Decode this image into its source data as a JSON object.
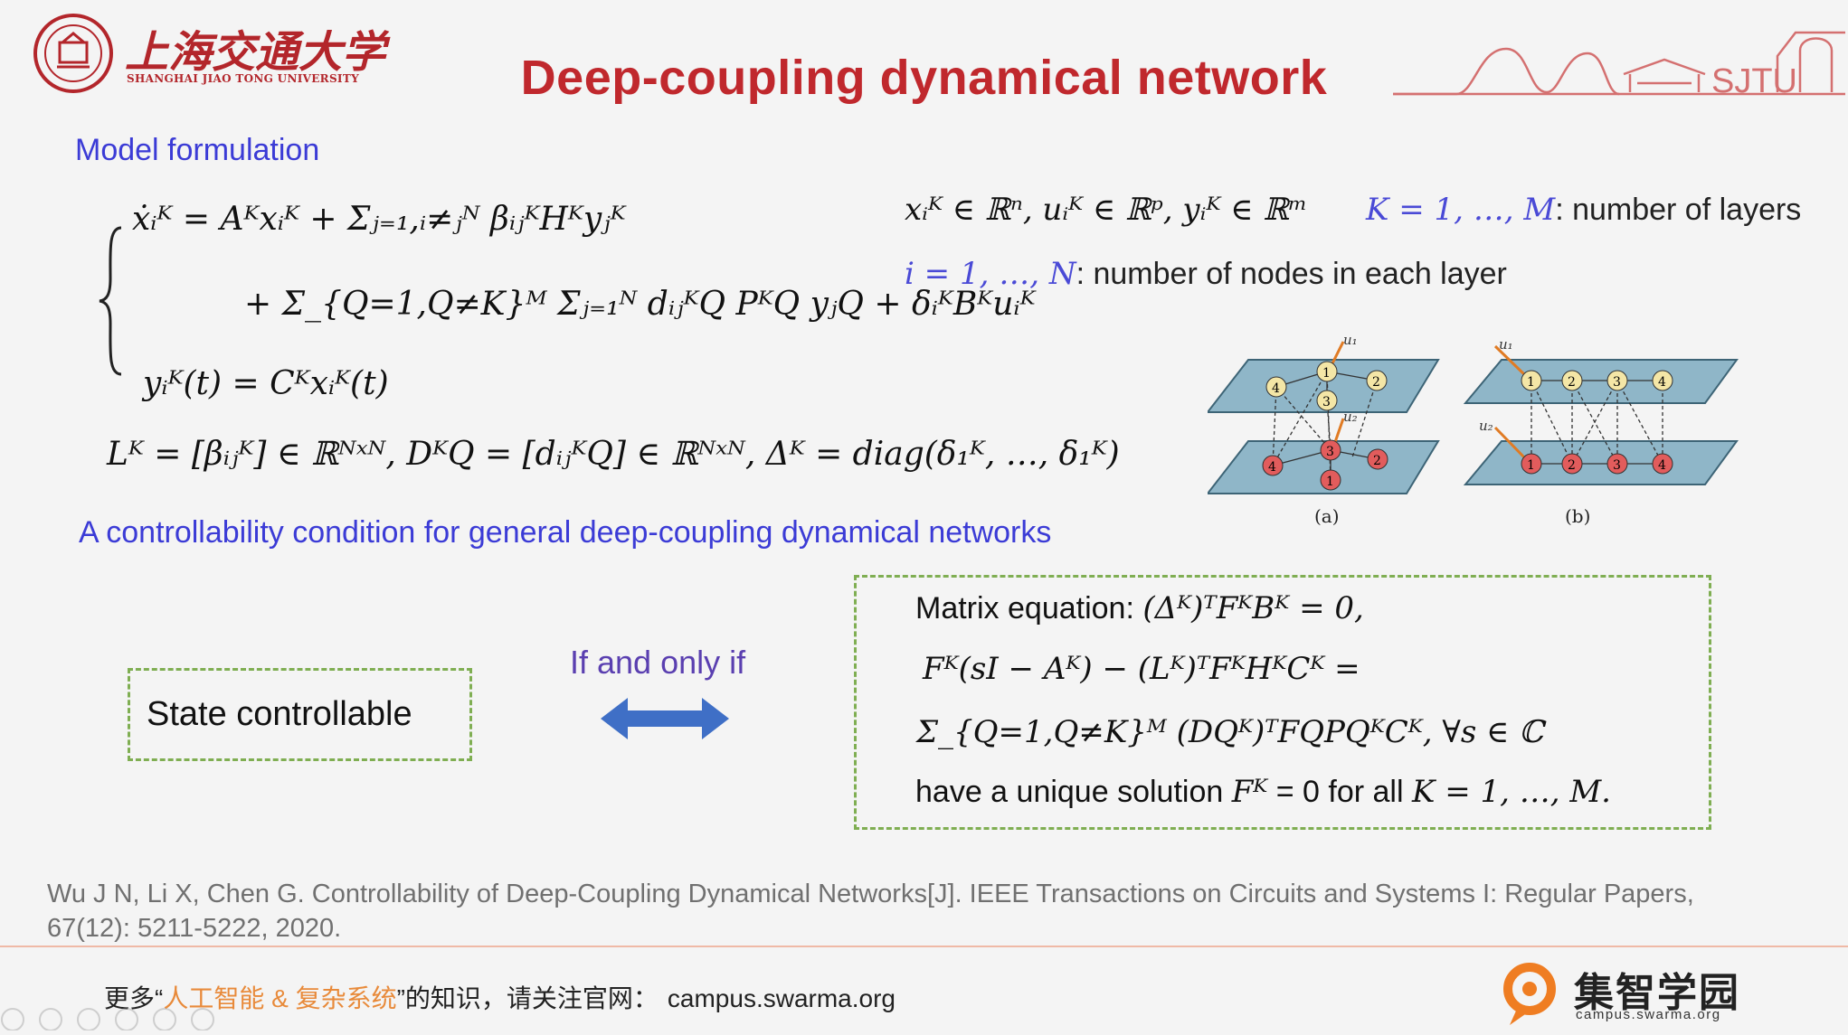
{
  "header": {
    "university_cn": "上海交通大学",
    "university_en": "SHANGHAI JIAO TONG UNIVERSITY",
    "title": "Deep-coupling dynamical network",
    "skyline_text": "SJTU"
  },
  "model": {
    "heading": "Model formulation",
    "eq1": "ẋᵢᴷ = Aᴷxᵢᴷ + Σⱼ₌₁,ᵢ≠ⱼᴺ βᵢⱼᴷHᴷyⱼᴷ",
    "eq2": "+ Σ_{Q=1,Q≠K}ᴹ Σⱼ₌₁ᴺ dᵢⱼᴷQ PᴷQ yⱼQ + δᵢᴷBᴷuᵢᴷ",
    "eq3": "yᵢᴷ(t) = Cᴷxᵢᴷ(t)",
    "eq4": "Lᴷ = [βᵢⱼᴷ] ∈ ℝᴺˣᴺ, DᴷQ = [dᵢⱼᴷQ] ∈ ℝᴺˣᴺ, Δᴷ = diag(δ₁ᴷ, …, δ₁ᴷ)",
    "dims": "xᵢᴷ ∈ ℝⁿ, uᵢᴷ ∈ ℝᵖ, yᵢᴷ ∈ ℝᵐ",
    "k_range": "K = 1, …, M",
    "k_desc": ": number of layers",
    "i_range": "i = 1, …, N",
    "i_desc": ": number of nodes in each layer"
  },
  "figure": {
    "caption_a": "(a)",
    "caption_b": "(b)",
    "node_labels_a_top": [
      "4",
      "1",
      "2",
      "3"
    ],
    "node_labels_a_bottom": [
      "4",
      "3",
      "2",
      "1"
    ],
    "node_labels_b_top": [
      "1",
      "2",
      "3",
      "4"
    ],
    "node_labels_b_bottom": [
      "1",
      "2",
      "3",
      "4"
    ],
    "input_labels": [
      "u₁",
      "u₂"
    ]
  },
  "condition": {
    "heading": "A controllability condition for general deep-coupling dynamical networks",
    "left_box": "State controllable",
    "arrow_label": "If and only if",
    "matrix_label": "Matrix equation: ",
    "line1_eq": "(Δᴷ)ᵀFᴷBᴷ = 0,",
    "line2_eq": "Fᴷ(sI − Aᴷ) − (Lᴷ)ᵀFᴷHᴷCᴷ =",
    "line3_eq": "Σ_{Q=1,Q≠K}ᴹ (DQᴷ)ᵀFQPQᴷCᴷ, ∀s ∈ ℂ",
    "line4_prefix": "have a unique solution ",
    "line4_var": "Fᴷ",
    "line4_mid": " = 0 for all ",
    "line4_range": "K = 1, …, M."
  },
  "reference": {
    "line1": "Wu J N, Li X, Chen G. Controllability of Deep-Coupling Dynamical Networks[J]. IEEE Transactions on Circuits and Systems I: Regular Papers,",
    "line2": "67(12): 5211-5222, 2020."
  },
  "footer": {
    "prefix": "更多“",
    "highlight": "人工智能 & 复杂系统",
    "suffix": "”的知识，请关注官网：",
    "url": "campus.swarma.org",
    "brand_cn": "集智学园",
    "brand_url": "campus.swarma.org"
  },
  "colors": {
    "title": "#c0282d",
    "section_blue": "#3b3bd6",
    "dash_green": "#7fae52",
    "arrow_blue": "#3f6fc6",
    "footer_orange": "#e88a3a",
    "layer_fill": "#8fb6c8",
    "node_red": "#e25c5c",
    "node_yellow": "#f4e6a6"
  }
}
